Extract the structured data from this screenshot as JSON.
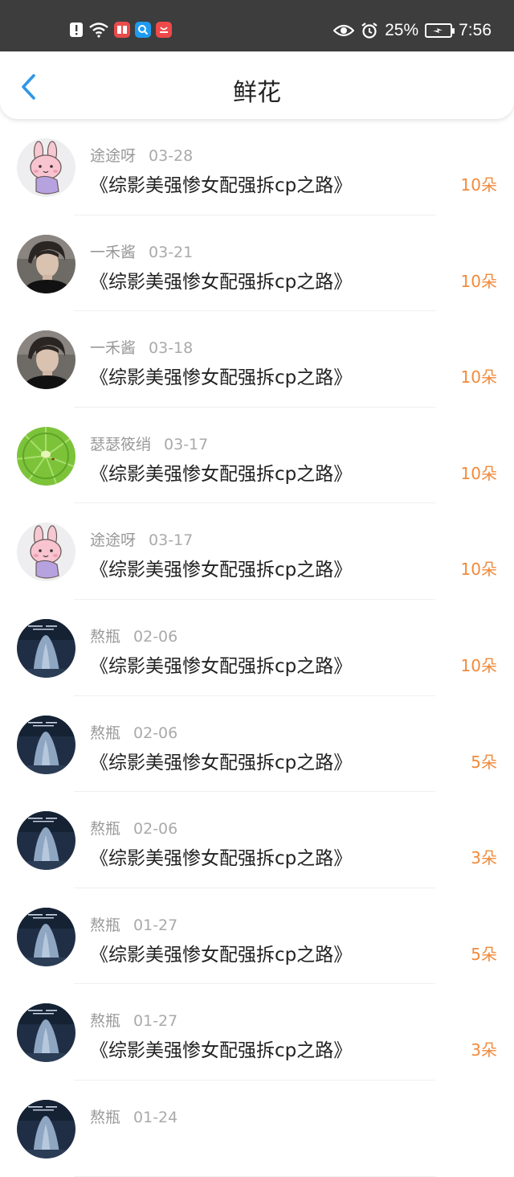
{
  "status_bar": {
    "battery": "25%",
    "time": "7:56",
    "icons": [
      "alert-icon",
      "wifi-icon",
      "red-book-app-icon",
      "blue-search-app-icon",
      "red-mall-app-icon",
      "eye-icon",
      "alarm-icon",
      "battery-icon"
    ]
  },
  "header": {
    "title": "鲜花",
    "back_icon": "chevron-left-icon"
  },
  "colors": {
    "accent": "#2e96e8",
    "count": "#f08a3c",
    "status_bar_bg": "#3d3d3d"
  },
  "rows": [
    {
      "user": "途途呀",
      "date": "03-28",
      "book": "《综影美强惨女配强拆cp之路》",
      "count": "10朵",
      "avatar": "bunny"
    },
    {
      "user": "一禾酱",
      "date": "03-21",
      "book": "《综影美强惨女配强拆cp之路》",
      "count": "10朵",
      "avatar": "person"
    },
    {
      "user": "一禾酱",
      "date": "03-18",
      "book": "《综影美强惨女配强拆cp之路》",
      "count": "10朵",
      "avatar": "person"
    },
    {
      "user": "瑟瑟筱绡",
      "date": "03-17",
      "book": "《综影美强惨女配强拆cp之路》",
      "count": "10朵",
      "avatar": "leaf"
    },
    {
      "user": "途途呀",
      "date": "03-17",
      "book": "《综影美强惨女配强拆cp之路》",
      "count": "10朵",
      "avatar": "bunny"
    },
    {
      "user": "熬瓶",
      "date": "02-06",
      "book": "《综影美强惨女配强拆cp之路》",
      "count": "10朵",
      "avatar": "night"
    },
    {
      "user": "熬瓶",
      "date": "02-06",
      "book": "《综影美强惨女配强拆cp之路》",
      "count": "5朵",
      "avatar": "night"
    },
    {
      "user": "熬瓶",
      "date": "02-06",
      "book": "《综影美强惨女配强拆cp之路》",
      "count": "3朵",
      "avatar": "night"
    },
    {
      "user": "熬瓶",
      "date": "01-27",
      "book": "《综影美强惨女配强拆cp之路》",
      "count": "5朵",
      "avatar": "night"
    },
    {
      "user": "熬瓶",
      "date": "01-27",
      "book": "《综影美强惨女配强拆cp之路》",
      "count": "3朵",
      "avatar": "night"
    },
    {
      "user": "熬瓶",
      "date": "01-24",
      "book": "",
      "count": "",
      "avatar": "night"
    }
  ]
}
